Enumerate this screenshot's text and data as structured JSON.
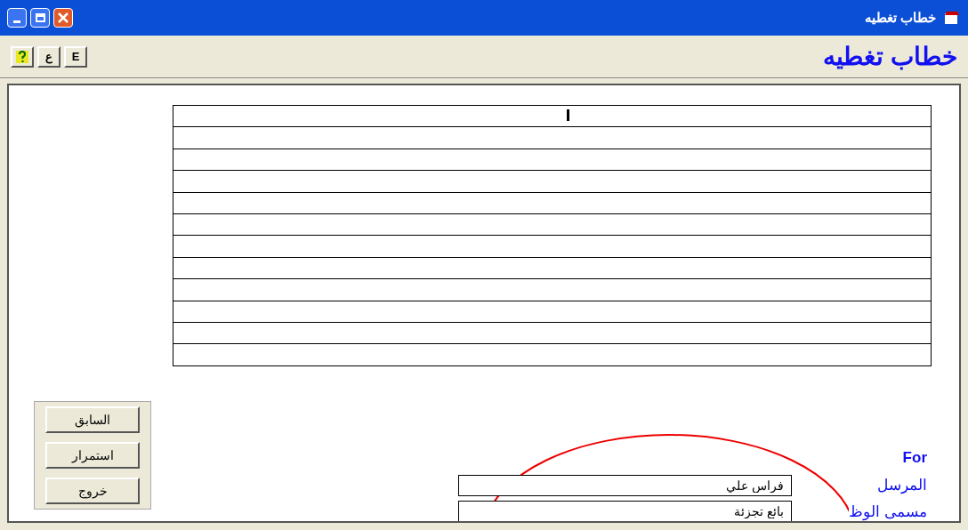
{
  "window": {
    "title": "خطاب تغطيه"
  },
  "toolbar": {
    "buttons": [
      {
        "kind": "text",
        "label": "E"
      },
      {
        "kind": "text",
        "label": "ع"
      },
      {
        "kind": "help"
      }
    ],
    "heading": "خطاب تغطيه"
  },
  "nav_buttons": [
    "السابق",
    "استمرار",
    "خروج"
  ],
  "form": {
    "for_label": "For",
    "fields": [
      {
        "label": "المرسل",
        "value": "فراس علي"
      },
      {
        "label": "مسمى الوظ",
        "value": "بائع تجزئة"
      }
    ]
  }
}
